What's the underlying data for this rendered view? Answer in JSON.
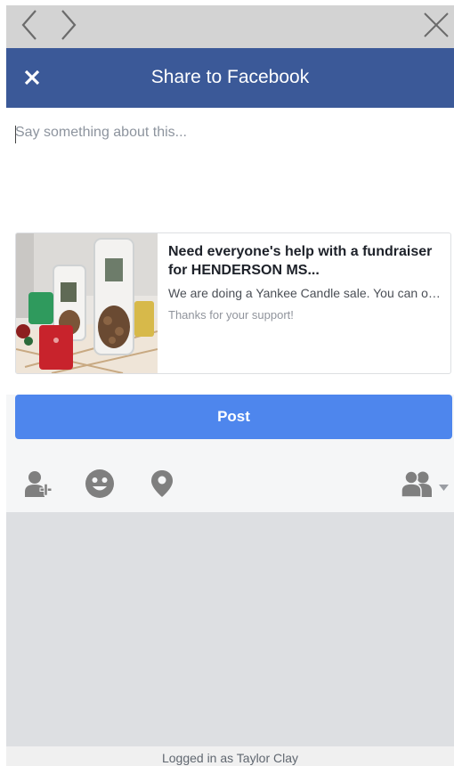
{
  "browser": {
    "back_icon": "chevron-left-icon",
    "forward_icon": "chevron-right-icon",
    "close_icon": "close-icon"
  },
  "header": {
    "title": "Share to Facebook",
    "close_icon": "close-icon"
  },
  "composer": {
    "placeholder": "Say something about this..."
  },
  "link_card": {
    "title": "Need everyone's help with a fundraiser for HENDERSON MS...",
    "description": "We are doing a Yankee Candle sale. You can order online...",
    "caption": "Thanks for your support!"
  },
  "post_button": {
    "label": "Post"
  },
  "toolbar": {
    "tag_icon": "tag-people-icon",
    "feeling_icon": "feeling-icon",
    "location_icon": "location-pin-icon",
    "audience_icon": "friends-audience-icon"
  },
  "footer": {
    "text": "Logged in as Taylor Clay"
  },
  "colors": {
    "header_bg": "#3b5998",
    "post_button": "#4e86ed",
    "toolbar_icons": "#7f7f7f"
  }
}
